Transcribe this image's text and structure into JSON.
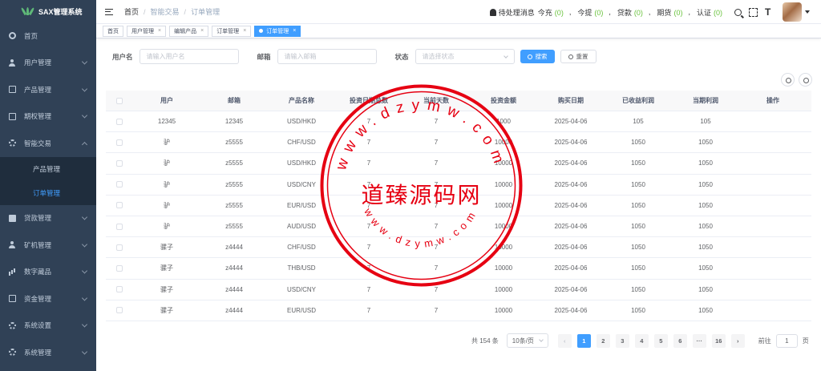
{
  "app": {
    "title": "SAX管理系统"
  },
  "sidebar": {
    "items": [
      {
        "label": "首页",
        "icon": "dashboard-icon",
        "has_children": false
      },
      {
        "label": "用户管理",
        "icon": "user-icon",
        "has_children": true
      },
      {
        "label": "产品管理",
        "icon": "document-icon",
        "has_children": true
      },
      {
        "label": "期权管理",
        "icon": "option-icon",
        "has_children": true
      },
      {
        "label": "智能交易",
        "icon": "gear-icon",
        "has_children": true,
        "expanded": true,
        "children": [
          {
            "label": "产品管理",
            "active": false
          },
          {
            "label": "订单管理",
            "active": true
          }
        ]
      },
      {
        "label": "贷款管理",
        "icon": "loan-icon",
        "has_children": true
      },
      {
        "label": "矿机管理",
        "icon": "miner-icon",
        "has_children": true
      },
      {
        "label": "数字藏品",
        "icon": "chart-icon",
        "has_children": true
      },
      {
        "label": "资金管理",
        "icon": "wallet-icon",
        "has_children": true
      },
      {
        "label": "系统设置",
        "icon": "settings-icon",
        "has_children": true
      },
      {
        "label": "系统管理",
        "icon": "system-icon",
        "has_children": true
      }
    ]
  },
  "header": {
    "breadcrumb": [
      "首页",
      "智能交易",
      "订单管理"
    ],
    "notice_label": "待处理消息",
    "notices": [
      {
        "label": "今充",
        "count": "0"
      },
      {
        "label": "今提",
        "count": "0"
      },
      {
        "label": "贷款",
        "count": "0"
      },
      {
        "label": "期货",
        "count": "0"
      },
      {
        "label": "认证",
        "count": "0"
      }
    ]
  },
  "tags": [
    {
      "label": "首页",
      "closable": false,
      "active": false
    },
    {
      "label": "用户管理",
      "closable": true,
      "active": false
    },
    {
      "label": "编辑产品",
      "closable": true,
      "active": false
    },
    {
      "label": "订单管理",
      "closable": true,
      "active": false
    },
    {
      "label": "订单管理",
      "closable": true,
      "active": true
    }
  ],
  "filter": {
    "username_label": "用户名",
    "username_placeholder": "请输入用户名",
    "email_label": "邮箱",
    "email_placeholder": "请输入邮箱",
    "status_label": "状态",
    "status_placeholder": "请选择状态",
    "search_label": "搜索",
    "reset_label": "重置"
  },
  "table": {
    "columns": [
      "用户",
      "邮箱",
      "产品名称",
      "投资日期总数",
      "当前天数",
      "投资金额",
      "购买日期",
      "已收益利润",
      "当期利润",
      "操作"
    ],
    "rows": [
      [
        "12345",
        "12345",
        "USD/HKD",
        "7",
        "7",
        "1000",
        "2025-04-06",
        "105",
        "105",
        ""
      ],
      [
        "驴",
        "z5555",
        "CHF/USD",
        "7",
        "7",
        "10000",
        "2025-04-06",
        "1050",
        "1050",
        ""
      ],
      [
        "驴",
        "z5555",
        "USD/HKD",
        "7",
        "7",
        "10000",
        "2025-04-06",
        "1050",
        "1050",
        ""
      ],
      [
        "驴",
        "z5555",
        "USD/CNY",
        "7",
        "7",
        "10000",
        "2025-04-06",
        "1050",
        "1050",
        ""
      ],
      [
        "驴",
        "z5555",
        "EUR/USD",
        "7",
        "7",
        "10000",
        "2025-04-06",
        "1050",
        "1050",
        ""
      ],
      [
        "驴",
        "z5555",
        "AUD/USD",
        "7",
        "7",
        "10000",
        "2025-04-06",
        "1050",
        "1050",
        ""
      ],
      [
        "骡子",
        "z4444",
        "CHF/USD",
        "7",
        "7",
        "10000",
        "2025-04-06",
        "1050",
        "1050",
        ""
      ],
      [
        "骡子",
        "z4444",
        "THB/USD",
        "7",
        "7",
        "10000",
        "2025-04-06",
        "1050",
        "1050",
        ""
      ],
      [
        "骡子",
        "z4444",
        "USD/CNY",
        "7",
        "7",
        "10000",
        "2025-04-06",
        "1050",
        "1050",
        ""
      ],
      [
        "骡子",
        "z4444",
        "EUR/USD",
        "7",
        "7",
        "10000",
        "2025-04-06",
        "1050",
        "1050",
        ""
      ]
    ]
  },
  "pagination": {
    "total": "共 154 条",
    "page_size": "10条/页",
    "pages": [
      "1",
      "2",
      "3",
      "4",
      "5",
      "6",
      "···",
      "16"
    ],
    "current": "1",
    "jump_prefix": "前往",
    "jump_value": "1",
    "jump_suffix": "页"
  },
  "watermark": {
    "center_text": "道臻源码网",
    "ring_text": "www.dzymw.com",
    "color": "#e60012"
  }
}
